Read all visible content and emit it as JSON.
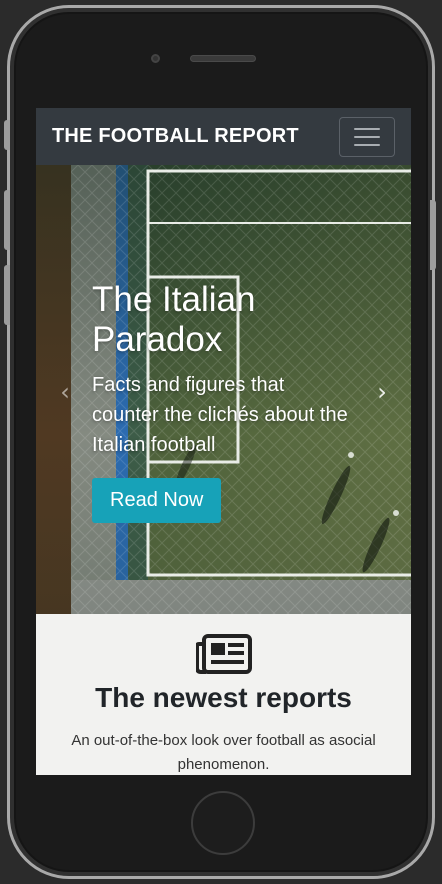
{
  "navbar": {
    "brand": "THE FOOTBALL REPORT"
  },
  "carousel": {
    "title": "The Italian Paradox",
    "caption": "Facts and figures that counter the clichés about the Italian football",
    "button_label": "Read Now",
    "prev_glyph": "‹",
    "next_glyph": "›"
  },
  "features": {
    "icon": "newspaper-icon",
    "title": "The newest reports",
    "text": "An out-of-the-box look over football as asocial phenomenon."
  },
  "colors": {
    "navbar_bg": "#343a40",
    "accent": "#17a2b8",
    "section_bg": "#f2f2f0"
  }
}
